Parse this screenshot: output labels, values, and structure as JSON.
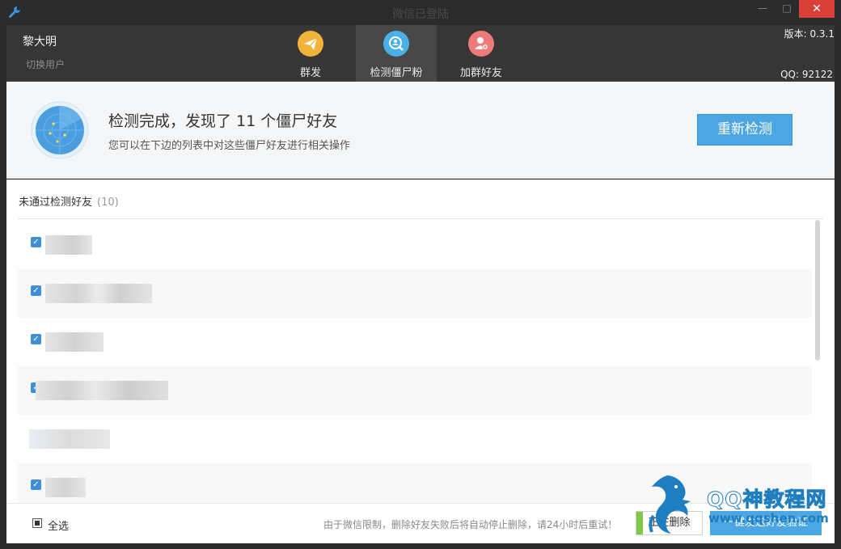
{
  "window": {
    "title": "微信已登陆",
    "min_glyph": "—",
    "max_glyph": "□",
    "close_glyph": "✕"
  },
  "header": {
    "user_name": "黎大明",
    "switch_user": "切换用户",
    "version": "版本: 0.3.1",
    "qq": "QQ: 92122",
    "tabs": [
      {
        "label": "群发",
        "icon": "send-icon",
        "color": "#f2b33b"
      },
      {
        "label": "检测僵尸粉",
        "icon": "detect-icon",
        "color": "#4bb0e8"
      },
      {
        "label": "加群好友",
        "icon": "add-friend-icon",
        "color": "#ef7a7a"
      }
    ],
    "active_tab": "检测僵尸粉"
  },
  "summary": {
    "title": "检测完成，发现了 11 个僵尸好友",
    "subtitle": "您可以在下边的列表中对这些僵尸好友进行相关操作",
    "recheck_label": "重新检测"
  },
  "list": {
    "title": "未通过检测好友",
    "count": "(10)",
    "rows_checked": [
      true,
      true,
      true,
      true,
      false,
      true
    ]
  },
  "footer": {
    "select_all": "全选",
    "notice": "由于微信限制，删除好友失败后将自动停止删除，请24小时后重试！",
    "deleting_label": "正在删除",
    "verify_label": "一键发送好友验证"
  },
  "watermark": {
    "text": "QQ神教程网",
    "url": "www.qqshen.com"
  },
  "colors": {
    "accent": "#4ba6e3",
    "close": "#d9403a",
    "header_bg": "#363636"
  }
}
